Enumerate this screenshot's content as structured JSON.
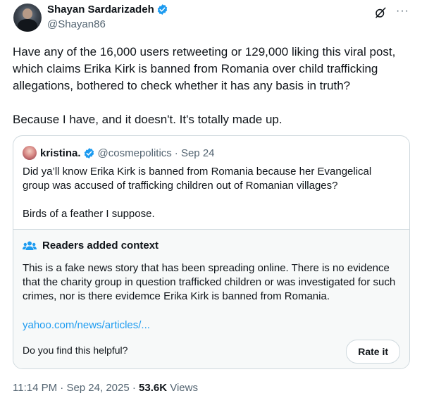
{
  "author": {
    "name": "Shayan Sardarizadeh",
    "handle": "@Shayan86"
  },
  "tweet": {
    "text": "Have any of the 16,000 users retweeting or 129,000 liking this viral post, which claims Erika Kirk is banned from Romania over child trafficking allegations, bothered to check whether it has any basis in truth?\n\nBecause I have, and it doesn't. It's totally made up."
  },
  "quoted": {
    "name": "kristina.",
    "handle": "@cosmepolitics",
    "date": "· Sep 24",
    "text": "Did ya’ll know Erika Kirk is banned from Romania because her Evangelical group was accused of trafficking children out of Romanian villages?\n\nBirds of a feather I suppose."
  },
  "context": {
    "title": "Readers added context",
    "text": "This is a fake news story that has been spreading online. There is no evidence that the charity group in question trafficked children or was investigated for such crimes, nor is there evidemce Erika Kirk is banned from Romania.",
    "link": "yahoo.com/news/articles/...",
    "helpful_question": "Do you find this helpful?",
    "rate_label": "Rate it"
  },
  "meta": {
    "time": "11:14 PM",
    "date": "Sep 24, 2025",
    "views_count": "53.6K",
    "views_label": "Views"
  },
  "colors": {
    "accent": "#1d9bf0",
    "text": "#0f1419",
    "secondary": "#536471",
    "border": "#cfd9de"
  },
  "icons": [
    "verified-badge-icon",
    "grok-icon",
    "more-icon",
    "readers-context-icon"
  ]
}
